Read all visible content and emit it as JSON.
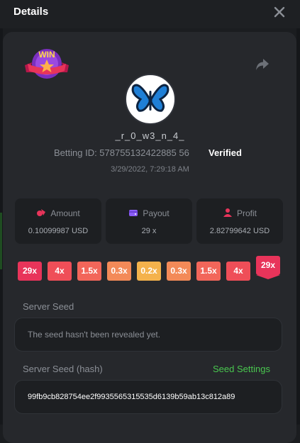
{
  "header": {
    "title": "Details"
  },
  "icons": {
    "close": "close-icon",
    "share": "share-icon",
    "win": "win-badge-icon",
    "avatar": "butterfly-avatar"
  },
  "player": {
    "username": "_r_0_w3_n_4_",
    "betting_id_label": "Betting ID: 578755132422885 56",
    "verified_label": "Verified",
    "timestamp": "3/29/2022, 7:29:18 AM"
  },
  "stats": [
    {
      "label": "Amount",
      "value": "0.10099987 USD",
      "icon": "amount-icon",
      "color": "#e8345a"
    },
    {
      "label": "Payout",
      "value": "29 x",
      "icon": "wallet-icon",
      "color": "#8a5cf6"
    },
    {
      "label": "Profit",
      "value": "2.82799642 USD",
      "icon": "profit-icon",
      "color": "#e8345a"
    }
  ],
  "multipliers": [
    {
      "label": "29x",
      "color": "#e8345a"
    },
    {
      "label": "4x",
      "color": "#ef4e58"
    },
    {
      "label": "1.5x",
      "color": "#f2665a"
    },
    {
      "label": "0.3x",
      "color": "#f38a58"
    },
    {
      "label": "0.2x",
      "color": "#f4b24c"
    },
    {
      "label": "0.3x",
      "color": "#f38a58"
    },
    {
      "label": "1.5x",
      "color": "#f2665a"
    },
    {
      "label": "4x",
      "color": "#ef4e58"
    },
    {
      "label": "29x",
      "color": "#e8345a",
      "highlighted": true
    }
  ],
  "seed": {
    "server_label": "Server Seed",
    "server_value": "The seed hasn't been revealed yet.",
    "hash_label": "Server Seed (hash)",
    "settings_link": "Seed Settings",
    "hash_value": "99fb9cb828754ee2f9935565315535d6139b59ab13c812a89"
  }
}
